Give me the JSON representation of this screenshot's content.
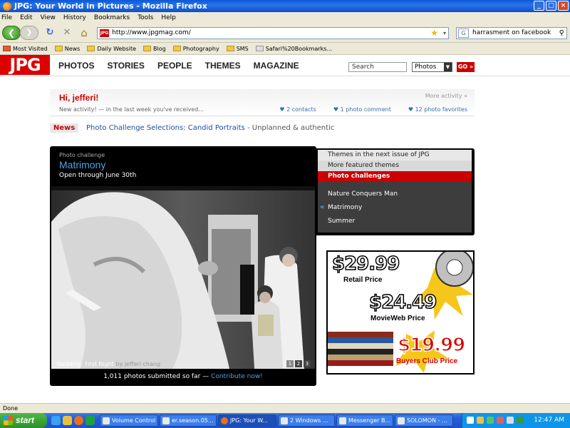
{
  "window": {
    "title": "JPG: Your World in Pictures - Mozilla Firefox",
    "min": "_",
    "max": "□",
    "close": "×"
  },
  "menu": [
    "File",
    "Edit",
    "View",
    "History",
    "Bookmarks",
    "Tools",
    "Help"
  ],
  "nav": {
    "back_glyph": "❮",
    "forward_glyph": "❯",
    "reload_glyph": "↻",
    "stop_glyph": "✕",
    "home_glyph": "⌂",
    "url": "http://www.jpgmag.com/",
    "favicon_text": "JPG",
    "star_glyph": "★",
    "dropdown_glyph": "▾",
    "search_engine": "G",
    "search_value": "harrasment on facebook",
    "search_glyph": "⚲"
  },
  "bookmarks": [
    "Most Visited",
    "News",
    "Daily Website",
    "Blog",
    "Photography",
    "SMS",
    "Safari%20Bookmarks..."
  ],
  "site": {
    "logo": "JPG",
    "nav": [
      "PHOTOS",
      "STORIES",
      "PEOPLE",
      "THEMES",
      "MAGAZINE"
    ],
    "search_placeholder": "Search",
    "search_scope": "Photos",
    "go_label": "GO »"
  },
  "greeting": {
    "hi": "Hi, jefferi!",
    "more_activity": "More activity »",
    "new_activity": "New activity! — in the last week you've received...",
    "stats": [
      "2 contacts",
      "1 photo comment",
      "12 photo favorites"
    ]
  },
  "news": {
    "tag": "News",
    "link": "Photo Challenge Selections: Candid Portraits",
    "extra": " - Unplanned & authentic"
  },
  "feature": {
    "label": "Photo challenge",
    "title": "Matrimony",
    "subtitle": "Open through June 30th",
    "caption": "Wedding: First Night",
    "caption_by": " by jefferi chang",
    "pages": [
      "1",
      "2",
      "3"
    ],
    "footer_count": "1,011 photos submitted so far — ",
    "footer_link": "Contribute now!"
  },
  "themes": {
    "tab1": "Themes in the next issue of JPG",
    "tab2": "More featured themes",
    "tab3": "Photo challenges",
    "items": [
      "Nature Conquers Man",
      "Matrimony",
      "Summer"
    ],
    "active_arrow": "«"
  },
  "ad": {
    "retail_price": "$29.99",
    "retail_label": "Retail Price",
    "movieweb_price": "$24.49",
    "movieweb_label": "MovieWeb Price",
    "club_price": "$19.99",
    "club_label": "Buyers Club Price"
  },
  "status": "Done",
  "taskbar": {
    "start": "start",
    "tasks": [
      "Volume Control",
      "er.season.05...",
      "JPG: Your W...",
      "2 Windows ...",
      "Messenger B...",
      "SOLOMON - ..."
    ],
    "clock": "12:47 AM"
  }
}
